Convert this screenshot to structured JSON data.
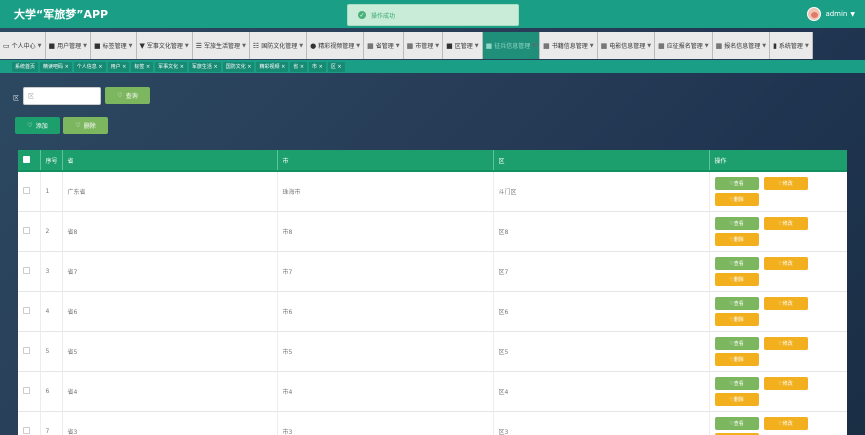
{
  "header": {
    "app_title": "大学“军旅梦”APP",
    "toast": "操作成功",
    "user": "admin"
  },
  "menu": [
    {
      "icon": "▭",
      "label": "个人中心"
    },
    {
      "icon": "■",
      "label": "用户管理"
    },
    {
      "icon": "■",
      "label": "标签管理"
    },
    {
      "icon": "▼",
      "label": "军事文化管理"
    },
    {
      "icon": "☰",
      "label": "军旅生活管理"
    },
    {
      "icon": "☷",
      "label": "国防文化管理"
    },
    {
      "icon": "●",
      "label": "精彩视频管理"
    },
    {
      "icon": "▦",
      "label": "省管理"
    },
    {
      "icon": "▦",
      "label": "市管理"
    },
    {
      "icon": "■",
      "label": "区管理"
    },
    {
      "icon": "■",
      "label": "征兵信息管理"
    },
    {
      "icon": "▦",
      "label": "书籍信息管理"
    },
    {
      "icon": "▦",
      "label": "电影信息管理"
    },
    {
      "icon": "▦",
      "label": "应征报名管理"
    },
    {
      "icon": "▦",
      "label": "报名信息管理"
    },
    {
      "icon": "▮",
      "label": "系统管理"
    }
  ],
  "tags": [
    "系统首页",
    "精读吧码 ×",
    "个人信息 ×",
    "用户 ×",
    "标签 ×",
    "军事文化 ×",
    "军旅生活 ×",
    "国防文化 ×",
    "精彩视频 ×",
    "省 ×",
    "市 ×",
    "区 ×"
  ],
  "search": {
    "label": "区",
    "placeholder": "区",
    "query_button": "查询"
  },
  "actions": {
    "add_button": "添加",
    "delete_button": "删除"
  },
  "table": {
    "headers": [
      "序号",
      "省",
      "市",
      "区",
      "操作"
    ],
    "rows": [
      {
        "index": "1",
        "province": "广东省",
        "city": "珠海市",
        "district": "斗门区"
      },
      {
        "index": "2",
        "province": "省8",
        "city": "市8",
        "district": "区8"
      },
      {
        "index": "3",
        "province": "省7",
        "city": "市7",
        "district": "区7"
      },
      {
        "index": "4",
        "province": "省6",
        "city": "市6",
        "district": "区6"
      },
      {
        "index": "5",
        "province": "省5",
        "city": "市5",
        "district": "区5"
      },
      {
        "index": "6",
        "province": "省4",
        "city": "市4",
        "district": "区4"
      },
      {
        "index": "7",
        "province": "省3",
        "city": "市3",
        "district": "区3"
      }
    ],
    "op_view": "查看",
    "op_edit": "修改",
    "op_delete": "删除"
  },
  "colors": {
    "header_bg": "#1a9e86",
    "table_header_bg": "#1c9f6c",
    "view_button": "#7cb65f",
    "edit_button": "#f2b01e"
  }
}
